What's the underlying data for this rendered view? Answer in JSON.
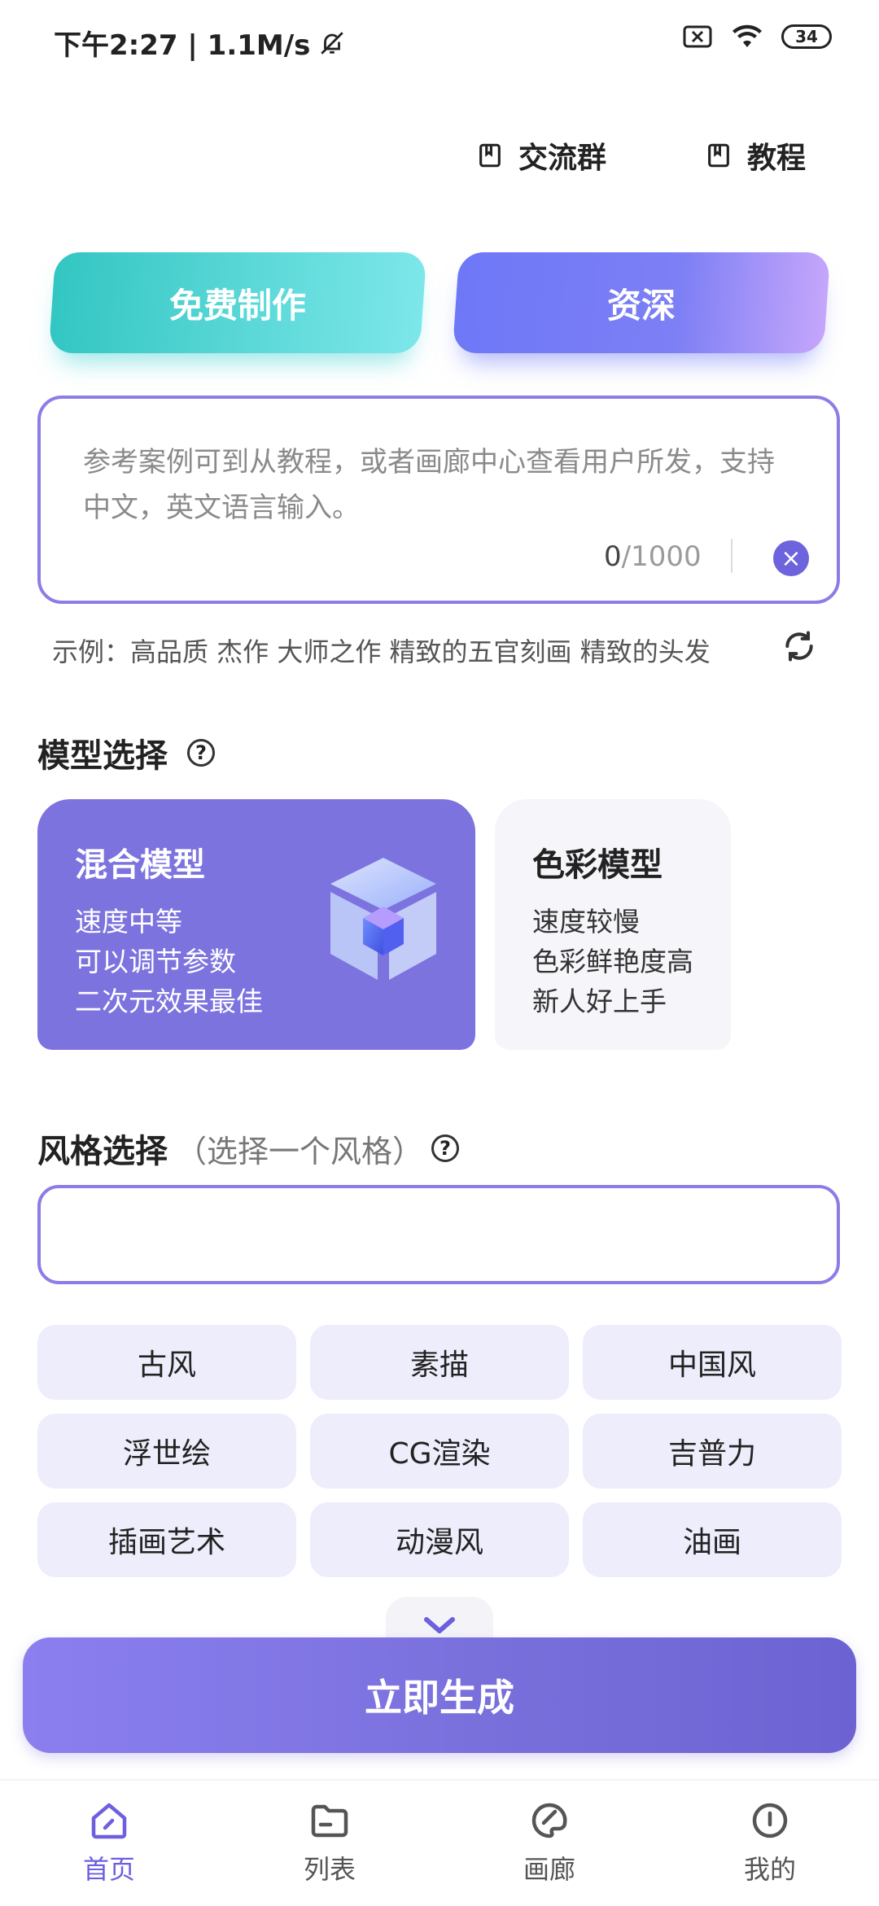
{
  "status_bar": {
    "time_speed": "下午2:27 | 1.1M/s",
    "battery": "34"
  },
  "top_links": {
    "group": "交流群",
    "tutorial": "教程"
  },
  "modes": {
    "free": "免费制作",
    "pro": "资深"
  },
  "prompt": {
    "placeholder": "参考案例可到从教程，或者画廊中心查看用户所发，支持中文，英文语言输入。",
    "count_current": "0",
    "count_max": "/1000"
  },
  "example": "示例：高品质 杰作 大师之作 精致的五官刻画 精致的头发",
  "model_section": {
    "title": "模型选择",
    "help": "?",
    "cards": [
      {
        "title": "混合模型",
        "lines": [
          "速度中等",
          "可以调节参数",
          "二次元效果最佳"
        ]
      },
      {
        "title": "色彩模型",
        "lines": [
          "速度较慢",
          "色彩鲜艳度高",
          "新人好上手"
        ]
      }
    ]
  },
  "style_section": {
    "title": "风格选择",
    "subtitle": "（选择一个风格）",
    "help": "?",
    "input_value": "",
    "chips": [
      "古风",
      "素描",
      "中国风",
      "浮世绘",
      "CG渲染",
      "吉普力",
      "插画艺术",
      "动漫风",
      "油画"
    ]
  },
  "generate_label": "立即生成",
  "nav": [
    {
      "label": "首页",
      "icon": "home-icon",
      "active": true
    },
    {
      "label": "列表",
      "icon": "folder-icon",
      "active": false
    },
    {
      "label": "画廊",
      "icon": "palette-icon",
      "active": false
    },
    {
      "label": "我的",
      "icon": "profile-icon",
      "active": false
    }
  ],
  "colors": {
    "accent": "#7d73df",
    "teal": "#33c6c2",
    "chip_bg": "#ededfb"
  }
}
